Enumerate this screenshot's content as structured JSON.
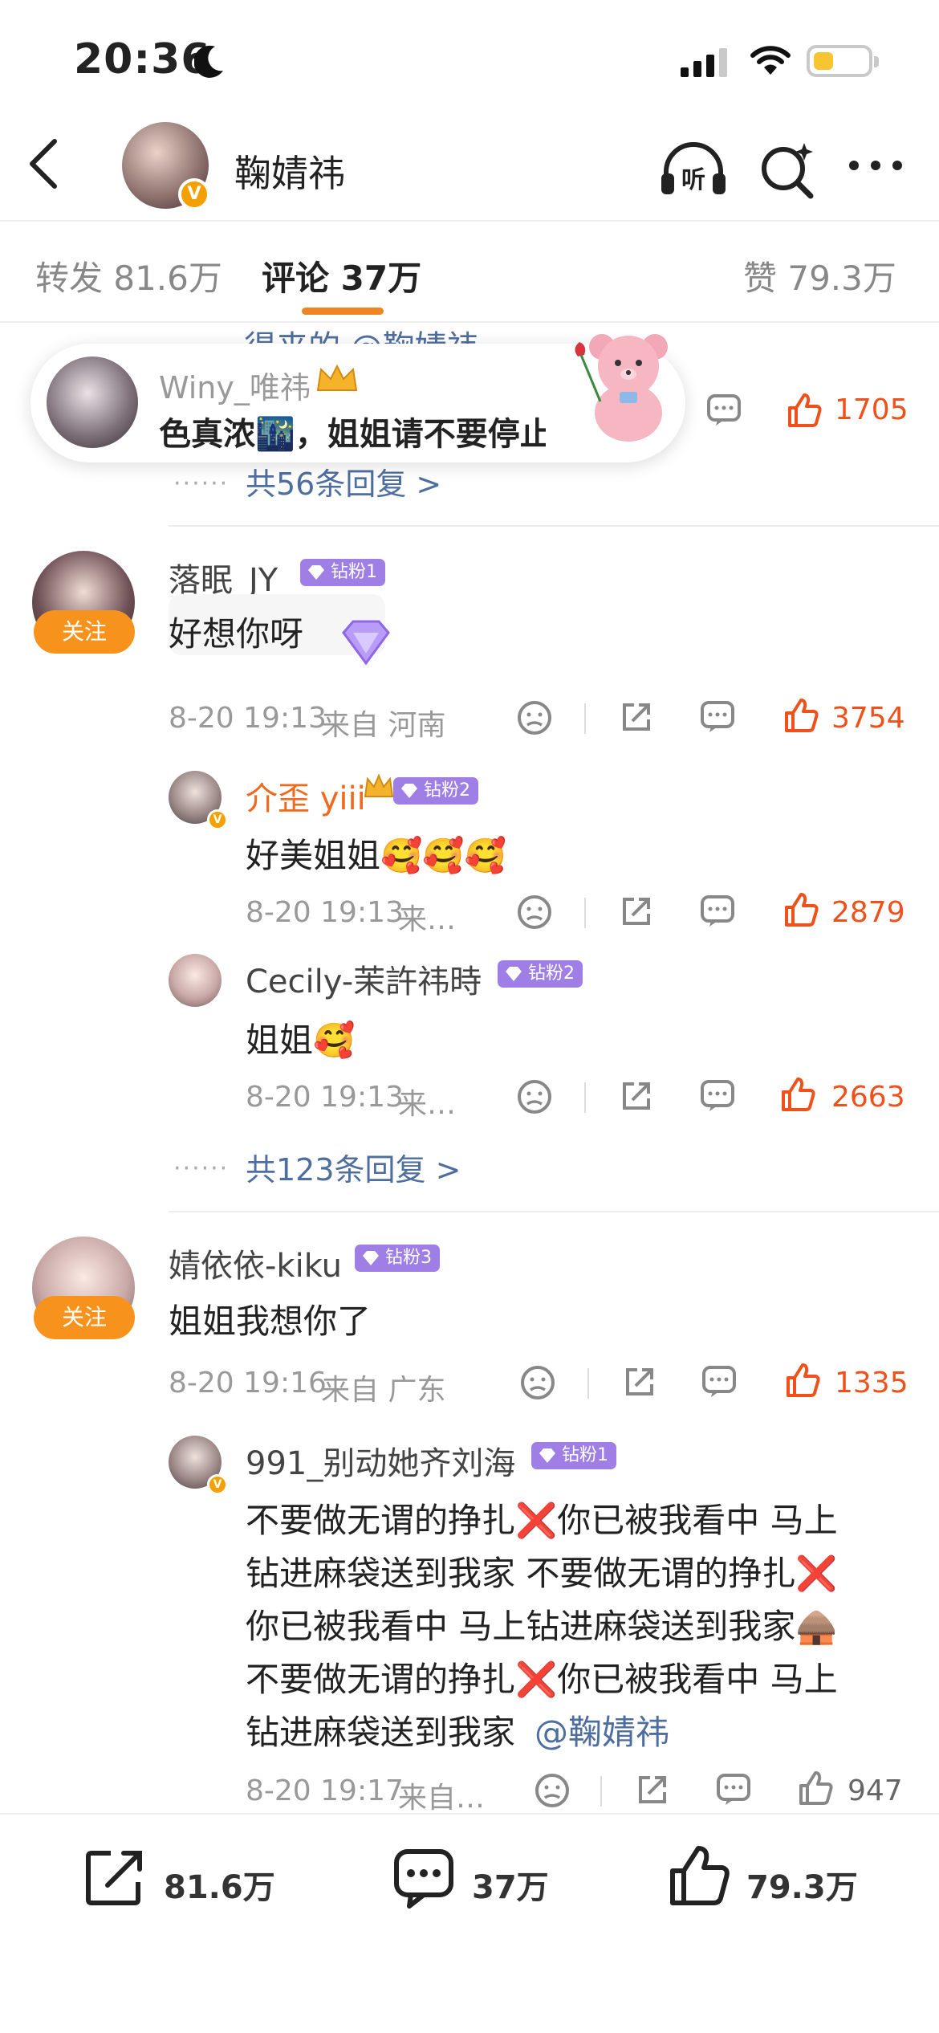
{
  "status_bar": {
    "time": "20:36"
  },
  "header": {
    "title": "鞠婧祎"
  },
  "tabs": [
    {
      "label": "转发 81.6万"
    },
    {
      "label": "评论 37万"
    },
    {
      "label": "赞 79.3万"
    }
  ],
  "toast": {
    "name": "Winy_唯祎",
    "text": "色真浓🌃，姐姐请不要停止"
  },
  "top_comment": {
    "partial_text": "得来的 @鞠婧祎",
    "likes": "1705",
    "more_replies": "共56条回复 >"
  },
  "comment1": {
    "name": "落眠_JY",
    "badge": "钻粉1",
    "follow": "关注",
    "text": "好想你呀",
    "date": "8-20 19:13",
    "location": "来自 河南",
    "likes": "3754",
    "replies": [
      {
        "name": "介歪 yiii",
        "badge": "钻粉2",
        "text": "好美姐姐🥰🥰🥰",
        "date": "8-20 19:13",
        "location": "来…",
        "likes": "2879"
      },
      {
        "name": "Cecily-茉許祎時",
        "badge": "钻粉2",
        "text": "姐姐🥰",
        "date": "8-20 19:13",
        "location": "来…",
        "likes": "2663"
      }
    ],
    "more_replies": "共123条回复 >"
  },
  "comment2": {
    "name": "婧依依-kiku",
    "badge": "钻粉3",
    "follow": "关注",
    "text": "姐姐我想你了",
    "date": "8-20 19:16",
    "location": "来自 广东",
    "likes": "1335",
    "reply": {
      "name": "991_别动她齐刘海",
      "badge": "钻粉1",
      "lines": [
        "不要做无谓的挣扎❌你已被我看中 马上",
        "钻进麻袋送到我家 不要做无谓的挣扎❌",
        "你已被我看中 马上钻进麻袋送到我家🛖",
        "不要做无谓的挣扎❌你已被我看中 马上",
        "钻进麻袋送到我家"
      ],
      "mention": "@鞠婧祎",
      "date": "8-20 19:17",
      "location": "来自…",
      "likes": "947"
    }
  },
  "bottom_bar": {
    "repost": "81.6万",
    "comment": "37万",
    "like": "79.3万"
  },
  "colors": {
    "accent": "#f08423",
    "like": "#f0511b",
    "link": "#4f6ea0",
    "badge": "#9f7fe6",
    "follow": "#f7931d"
  },
  "icons": [
    "moon-icon",
    "signal-icon",
    "wifi-icon",
    "battery-icon",
    "back-icon",
    "verified-icon",
    "headphone-icon",
    "search-icon",
    "more-icon",
    "emoji-icon",
    "share-icon",
    "comment-icon",
    "like-icon",
    "diamond-icon",
    "bear-icon"
  ]
}
